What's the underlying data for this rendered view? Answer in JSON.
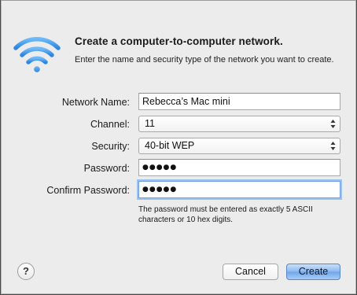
{
  "dialog": {
    "title": "Create a computer-to-computer network.",
    "description": "Enter the name and security type of the network you want to create.",
    "icon": "wifi-icon",
    "accent_color": "#3b8de3"
  },
  "form": {
    "network_name": {
      "label": "Network Name:",
      "value": "Rebecca’s Mac mini"
    },
    "channel": {
      "label": "Channel:",
      "value": "11"
    },
    "security": {
      "label": "Security:",
      "value": "40-bit WEP"
    },
    "password": {
      "label": "Password:",
      "value": "●●●●●"
    },
    "confirm_password": {
      "label": "Confirm Password:",
      "value": "●●●●●"
    },
    "hint": "The password must be entered as exactly 5 ASCII characters or 10 hex digits."
  },
  "buttons": {
    "help": "?",
    "cancel": "Cancel",
    "create": "Create"
  }
}
